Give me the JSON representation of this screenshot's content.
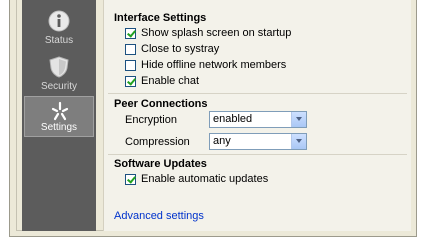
{
  "sidebar": {
    "items": [
      {
        "label": "Status",
        "icon": "info-icon",
        "active": false
      },
      {
        "label": "Security",
        "icon": "shield-icon",
        "active": false
      },
      {
        "label": "Settings",
        "icon": "settings-icon",
        "active": true
      }
    ]
  },
  "interface_settings": {
    "title": "Interface Settings",
    "options": [
      {
        "label": "Show splash screen on startup",
        "checked": true
      },
      {
        "label": "Close to systray",
        "checked": false
      },
      {
        "label": "Hide offline network members",
        "checked": false
      },
      {
        "label": "Enable chat",
        "checked": true
      }
    ]
  },
  "peer_connections": {
    "title": "Peer Connections",
    "encryption_label": "Encryption",
    "encryption_value": "enabled",
    "compression_label": "Compression",
    "compression_value": "any"
  },
  "software_updates": {
    "title": "Software Updates",
    "auto_update_label": "Enable automatic updates",
    "auto_update_checked": true
  },
  "advanced_link": "Advanced settings",
  "colors": {
    "sidebar_bg": "#5c5c5c",
    "sidebar_active": "#7e7e7e",
    "panel_bg": "#f3f2ea",
    "link": "#0033cc",
    "check": "#21a121"
  }
}
